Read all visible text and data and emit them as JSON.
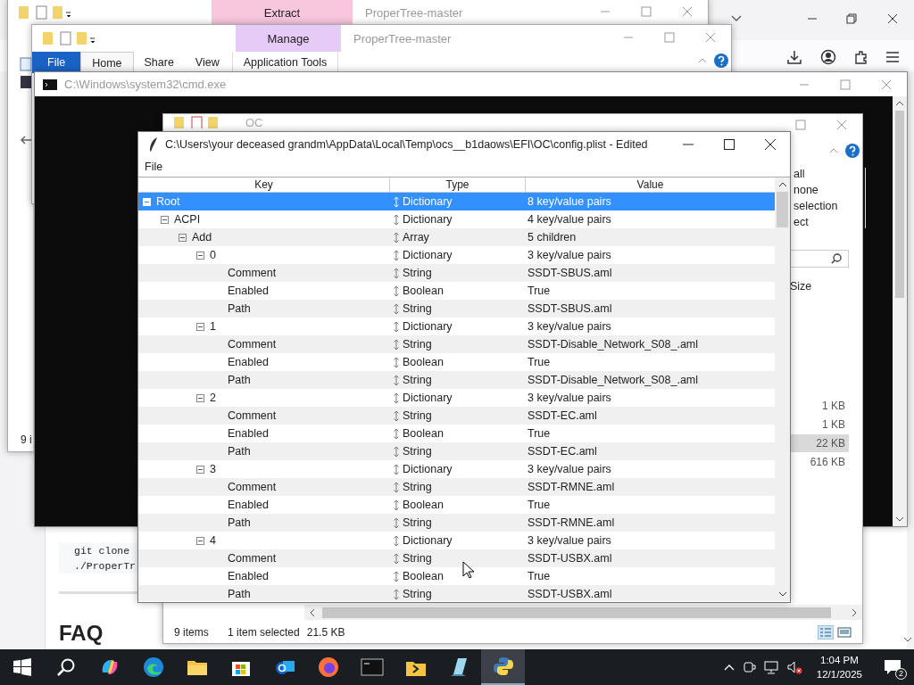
{
  "browser": {
    "page": [
      {
        "kind": "code",
        "text": "git clone"
      },
      {
        "kind": "code",
        "text": "./ProperTr"
      },
      {
        "kind": "heading",
        "text": "FAQ"
      }
    ]
  },
  "explorer_back": {
    "context_tab": "Extract",
    "title": "ProperTree-master",
    "status": "9 i"
  },
  "explorer_middle": {
    "context_tab": "Manage",
    "title": "ProperTree-master",
    "tabs": [
      {
        "label": "File",
        "kind": "file",
        "selected": false
      },
      {
        "label": "Home",
        "kind": "tab",
        "selected": true
      },
      {
        "label": "Share",
        "kind": "tab",
        "selected": false
      },
      {
        "label": "View",
        "kind": "tab",
        "selected": false
      },
      {
        "label": "Application Tools",
        "kind": "context",
        "selected": false
      }
    ]
  },
  "cmd": {
    "title": "C:\\Windows\\system32\\cmd.exe"
  },
  "explorer_front": {
    "title": "OC",
    "ribbon_items": [
      "all",
      "none",
      "selection",
      "ect"
    ],
    "size_column": "Size",
    "sizes": [
      {
        "text": "1 KB",
        "selected": false
      },
      {
        "text": "1 KB",
        "selected": false
      },
      {
        "text": "22 KB",
        "selected": true
      },
      {
        "text": "616 KB",
        "selected": false
      }
    ],
    "status": [
      "9 items",
      "1 item selected",
      "21.5 KB"
    ]
  },
  "propertree": {
    "title": "C:\\Users\\your deceased grandm\\AppData\\Local\\Temp\\ocs__b1daows\\EFI\\OC\\config.plist - Edited",
    "menu": [
      "File"
    ],
    "columns": [
      "Key",
      "Type",
      "Value"
    ],
    "tree": [
      {
        "key": "Root",
        "type": "Dictionary",
        "value": "8 key/value pairs",
        "selected": true,
        "expanded": true,
        "children": [
          {
            "key": "ACPI",
            "type": "Dictionary",
            "value": "4 key/value pairs",
            "selected": false,
            "expanded": true,
            "children": [
              {
                "key": "Add",
                "type": "Array",
                "value": "5 children",
                "selected": false,
                "expanded": true,
                "children": [
                  {
                    "key": "0",
                    "type": "Dictionary",
                    "value": "3 key/value pairs",
                    "selected": false,
                    "expanded": true,
                    "children": [
                      {
                        "key": "Comment",
                        "type": "String",
                        "value": "SSDT-SBUS.aml",
                        "selected": false
                      },
                      {
                        "key": "Enabled",
                        "type": "Boolean",
                        "value": "True",
                        "selected": false
                      },
                      {
                        "key": "Path",
                        "type": "String",
                        "value": "SSDT-SBUS.aml",
                        "selected": false
                      }
                    ]
                  },
                  {
                    "key": "1",
                    "type": "Dictionary",
                    "value": "3 key/value pairs",
                    "selected": false,
                    "expanded": true,
                    "children": [
                      {
                        "key": "Comment",
                        "type": "String",
                        "value": "SSDT-Disable_Network_S08_.aml",
                        "selected": false
                      },
                      {
                        "key": "Enabled",
                        "type": "Boolean",
                        "value": "True",
                        "selected": false
                      },
                      {
                        "key": "Path",
                        "type": "String",
                        "value": "SSDT-Disable_Network_S08_.aml",
                        "selected": false
                      }
                    ]
                  },
                  {
                    "key": "2",
                    "type": "Dictionary",
                    "value": "3 key/value pairs",
                    "selected": false,
                    "expanded": true,
                    "children": [
                      {
                        "key": "Comment",
                        "type": "String",
                        "value": "SSDT-EC.aml",
                        "selected": false
                      },
                      {
                        "key": "Enabled",
                        "type": "Boolean",
                        "value": "True",
                        "selected": false
                      },
                      {
                        "key": "Path",
                        "type": "String",
                        "value": "SSDT-EC.aml",
                        "selected": false
                      }
                    ]
                  },
                  {
                    "key": "3",
                    "type": "Dictionary",
                    "value": "3 key/value pairs",
                    "selected": false,
                    "expanded": true,
                    "children": [
                      {
                        "key": "Comment",
                        "type": "String",
                        "value": "SSDT-RMNE.aml",
                        "selected": false
                      },
                      {
                        "key": "Enabled",
                        "type": "Boolean",
                        "value": "True",
                        "selected": false
                      },
                      {
                        "key": "Path",
                        "type": "String",
                        "value": "SSDT-RMNE.aml",
                        "selected": false
                      }
                    ]
                  },
                  {
                    "key": "4",
                    "type": "Dictionary",
                    "value": "3 key/value pairs",
                    "selected": false,
                    "expanded": true,
                    "children": [
                      {
                        "key": "Comment",
                        "type": "String",
                        "value": "SSDT-USBX.aml",
                        "selected": false
                      },
                      {
                        "key": "Enabled",
                        "type": "Boolean",
                        "value": "True",
                        "selected": false
                      },
                      {
                        "key": "Path",
                        "type": "String",
                        "value": "SSDT-USBX.aml",
                        "selected": false
                      }
                    ]
                  }
                ]
              }
            ]
          }
        ]
      }
    ]
  },
  "taskbar": {
    "apps": [
      {
        "kind": "start",
        "active": false
      },
      {
        "kind": "search",
        "active": false
      },
      {
        "kind": "copilot",
        "active": false
      },
      {
        "kind": "edge",
        "active": false
      },
      {
        "kind": "folder",
        "active": false
      },
      {
        "kind": "store",
        "active": false
      },
      {
        "kind": "mail",
        "active": false
      },
      {
        "kind": "firefox",
        "active": false
      },
      {
        "kind": "terminal",
        "active": false
      },
      {
        "kind": "script",
        "active": false
      },
      {
        "kind": "glass",
        "active": false
      },
      {
        "kind": "python",
        "active": true
      }
    ],
    "time": "1:04 PM",
    "date": "12/1/2025",
    "notifications": "2"
  }
}
